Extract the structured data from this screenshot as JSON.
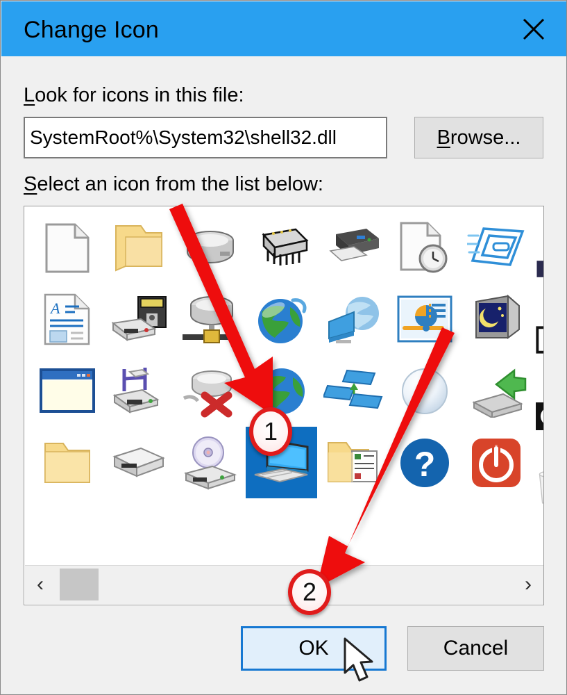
{
  "window": {
    "title": "Change Icon",
    "close_icon": "close-icon",
    "titlebar_color": "#29a0f0"
  },
  "form": {
    "file_label": "Look for icons in this file:",
    "file_label_accel": "L",
    "path_value": "SystemRoot%\\System32\\shell32.dll",
    "path_placeholder": "",
    "browse_label": "Browse...",
    "browse_accel": "B",
    "list_label": "Select an icon from the list below:",
    "list_label_accel": "S"
  },
  "icon_list": {
    "selected_index": 24,
    "columns": 7,
    "rows": 4,
    "icons": [
      {
        "index": 0,
        "name": "blank-document-icon"
      },
      {
        "index": 1,
        "name": "folder-open-icon"
      },
      {
        "index": 2,
        "name": "hard-drive-icon"
      },
      {
        "index": 3,
        "name": "memory-chip-icon"
      },
      {
        "index": 4,
        "name": "printer-icon"
      },
      {
        "index": 5,
        "name": "recent-document-clock-icon"
      },
      {
        "index": 6,
        "name": "blue-window-stack-icon"
      },
      {
        "index": 7,
        "name": "rich-text-document-icon"
      },
      {
        "index": 8,
        "name": "floppy-drive-icon"
      },
      {
        "index": 9,
        "name": "network-drive-icon"
      },
      {
        "index": 10,
        "name": "internet-globe-icon"
      },
      {
        "index": 11,
        "name": "network-computer-icon"
      },
      {
        "index": 12,
        "name": "control-panel-icon"
      },
      {
        "index": 13,
        "name": "display-settings-icon"
      },
      {
        "index": 14,
        "name": "application-window-icon"
      },
      {
        "index": 15,
        "name": "install-drive-icon"
      },
      {
        "index": 16,
        "name": "disconnected-drive-icon"
      },
      {
        "index": 17,
        "name": "internet-globe-small-icon"
      },
      {
        "index": 18,
        "name": "network-workgroup-icon"
      },
      {
        "index": 19,
        "name": "sphere-ball-icon"
      },
      {
        "index": 20,
        "name": "green-arrow-drive-icon"
      },
      {
        "index": 21,
        "name": "folder-closed-icon"
      },
      {
        "index": 22,
        "name": "hard-disk-icon"
      },
      {
        "index": 23,
        "name": "cd-drive-icon"
      },
      {
        "index": 24,
        "name": "this-pc-computer-icon"
      },
      {
        "index": 25,
        "name": "folder-documents-icon"
      },
      {
        "index": 26,
        "name": "help-question-icon"
      },
      {
        "index": 27,
        "name": "shutdown-power-icon"
      }
    ],
    "edge_icons": [
      {
        "name": "battery-icon"
      },
      {
        "name": "shortcut-arrow-icon"
      },
      {
        "name": "clock-black-icon"
      },
      {
        "name": "recycle-bin-icon"
      }
    ],
    "scrollbar": {
      "left_arrow": "‹",
      "right_arrow": "›",
      "left_arrow_icon": "chevron-left-icon",
      "right_arrow_icon": "chevron-right-icon"
    }
  },
  "buttons": {
    "ok_label": "OK",
    "cancel_label": "Cancel"
  },
  "annotations": {
    "marker_1": "1",
    "marker_2": "2",
    "arrow_color": "#ee1111"
  }
}
